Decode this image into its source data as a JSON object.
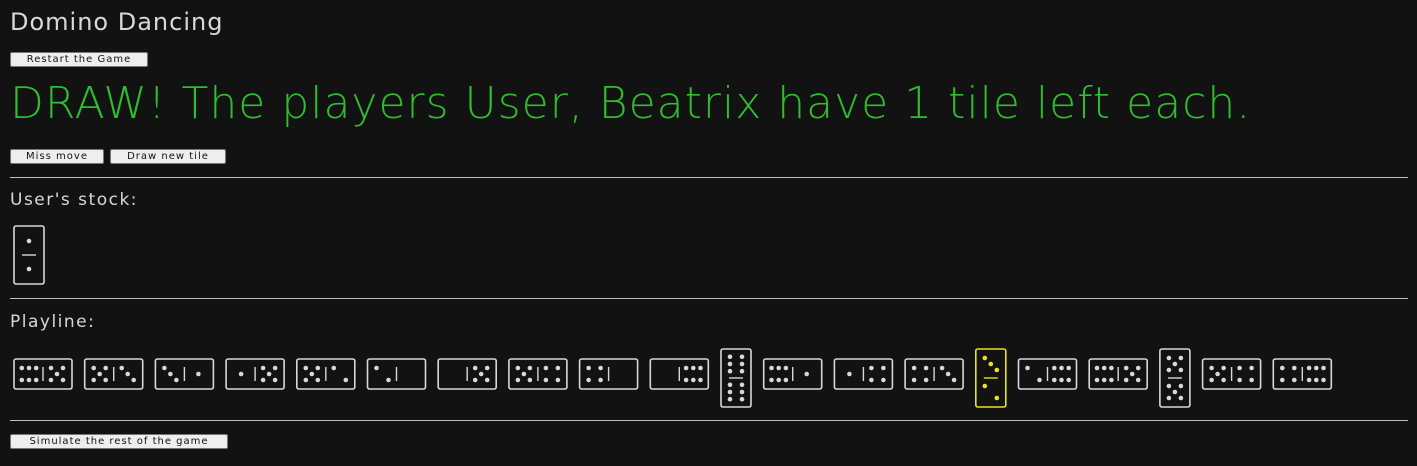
{
  "page": {
    "title": "Domino Dancing",
    "restart_label": "Restart the Game",
    "status_text": "DRAW! The players User, Beatrix have 1 tile left each.",
    "miss_label": "Miss move",
    "draw_label": "Draw new tile",
    "stock_label": "User's stock:",
    "playline_label": "Playline:",
    "simulate_label": "Simulate the rest of the game"
  },
  "colors": {
    "background": "#121212",
    "status": "#2fbd2f",
    "tile_stroke": "#d8d8d8",
    "highlight": "#e8e020",
    "button_bg": "#eeeeee"
  },
  "user_stock": [
    {
      "a": 1,
      "b": 1,
      "orientation": "vertical"
    }
  ],
  "playline": [
    {
      "a": 6,
      "b": 5,
      "orientation": "horizontal"
    },
    {
      "a": 5,
      "b": 3,
      "orientation": "horizontal"
    },
    {
      "a": 3,
      "b": 1,
      "orientation": "horizontal"
    },
    {
      "a": 1,
      "b": 5,
      "orientation": "horizontal"
    },
    {
      "a": 5,
      "b": 2,
      "orientation": "horizontal"
    },
    {
      "a": 2,
      "b": 0,
      "orientation": "horizontal"
    },
    {
      "a": 0,
      "b": 5,
      "orientation": "horizontal"
    },
    {
      "a": 5,
      "b": 4,
      "orientation": "horizontal"
    },
    {
      "a": 4,
      "b": 0,
      "orientation": "horizontal"
    },
    {
      "a": 0,
      "b": 6,
      "orientation": "horizontal"
    },
    {
      "a": 6,
      "b": 6,
      "orientation": "vertical"
    },
    {
      "a": 6,
      "b": 1,
      "orientation": "horizontal"
    },
    {
      "a": 1,
      "b": 4,
      "orientation": "horizontal"
    },
    {
      "a": 4,
      "b": 3,
      "orientation": "horizontal"
    },
    {
      "a": 3,
      "b": 2,
      "orientation": "vertical",
      "highlight": true
    },
    {
      "a": 2,
      "b": 6,
      "orientation": "horizontal"
    },
    {
      "a": 6,
      "b": 5,
      "orientation": "horizontal"
    },
    {
      "a": 5,
      "b": 5,
      "orientation": "vertical"
    },
    {
      "a": 5,
      "b": 4,
      "orientation": "horizontal"
    },
    {
      "a": 4,
      "b": 6,
      "orientation": "horizontal"
    }
  ]
}
